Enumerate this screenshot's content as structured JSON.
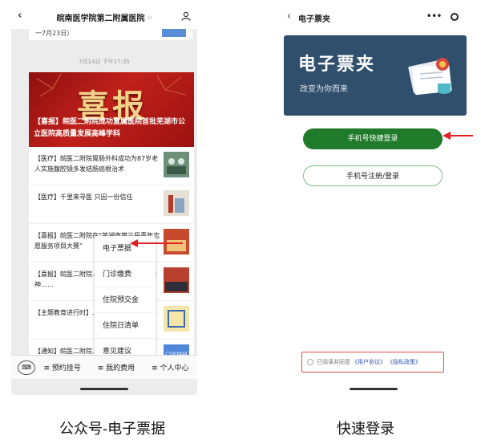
{
  "left_phone": {
    "nav_title": "皖南医学院第二附属医院",
    "nav_title_suffix": "⌂",
    "prev_card_text": "一7月23日）",
    "timestamp": "7月14日 下午17:35",
    "banner": {
      "big_char": "喜报",
      "caption": "【喜报】皖医二附院成功直属医院首批芜湖市公立医院高质量发展高峰学科"
    },
    "feed_items": [
      {
        "text": "【医疗】皖医二附院胃肠外科成功为87岁老人实施腹腔镜多发结肠癌根治术"
      },
      {
        "text": "【医疗】千里来寻医 只因一份信任"
      },
      {
        "text": "【喜报】皖医二附院在“芜湖市第三届青年志愿服务项目大赛”"
      },
      {
        "text": "【喜报】皖医二附院……学习党的二十大精神……"
      },
      {
        "text": "【主题教育进行时】……经典（七）"
      },
      {
        "text": "【通知】皖医二附院……7日—7月23日）"
      }
    ],
    "side_thumb_text": "门诊排班",
    "menu_items": [
      "电子票据",
      "门诊缴费",
      "住院预交金",
      "住院日清单",
      "意见建议"
    ],
    "tabbar": {
      "keyboard_icon": "⌨",
      "tabs": [
        "≡ 预约挂号",
        "≡ 我的费用",
        "≡ 个人中心"
      ]
    }
  },
  "right_phone": {
    "nav_title": "电子票夹",
    "capsule_dots": "•••",
    "hero_title": "电子票夹",
    "hero_subtitle": "改变为你而来",
    "primary_button": "手机号快捷登录",
    "secondary_button": "手机号注册/登录",
    "agree_text": "已阅读并同意",
    "agree_link1": "《用户协议》",
    "agree_link2": "《隐私政策》"
  },
  "captions": {
    "left": "公众号-电子票据",
    "right": "快速登录"
  },
  "colors": {
    "banner_red": "#c0201a",
    "hero_navy": "#2f4f6c",
    "primary_green": "#1f7a2a",
    "arrow_red": "#e02020",
    "link_blue": "#2f56b8"
  }
}
